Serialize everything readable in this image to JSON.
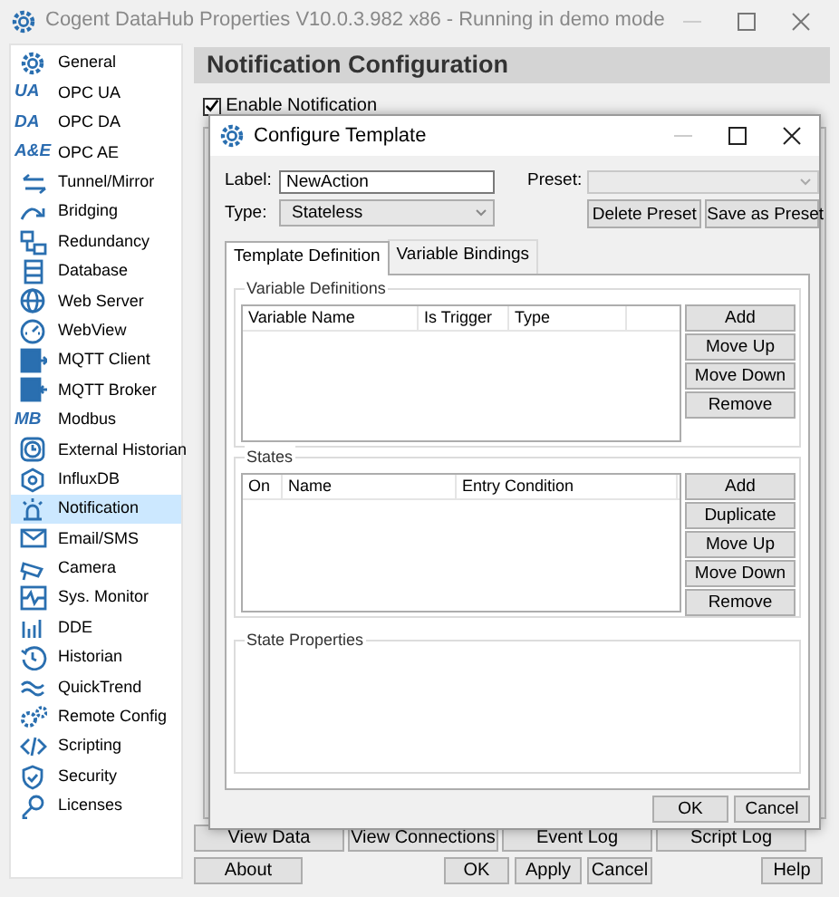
{
  "window": {
    "title": "Cogent DataHub Properties V10.0.3.982 x86 - Running in demo mode"
  },
  "sidebar": {
    "items": [
      {
        "label": "General",
        "selected": false
      },
      {
        "label": "OPC UA",
        "badge": "UA",
        "selected": false
      },
      {
        "label": "OPC DA",
        "badge": "DA",
        "selected": false
      },
      {
        "label": "OPC AE",
        "badge": "A&E",
        "selected": false
      },
      {
        "label": "Tunnel/Mirror",
        "selected": false
      },
      {
        "label": "Bridging",
        "selected": false
      },
      {
        "label": "Redundancy",
        "selected": false
      },
      {
        "label": "Database",
        "selected": false
      },
      {
        "label": "Web Server",
        "selected": false
      },
      {
        "label": "WebView",
        "selected": false
      },
      {
        "label": "MQTT Client",
        "selected": false
      },
      {
        "label": "MQTT Broker",
        "selected": false
      },
      {
        "label": "Modbus",
        "badge": "MB",
        "selected": false
      },
      {
        "label": "External Historian",
        "selected": false
      },
      {
        "label": "InfluxDB",
        "selected": false
      },
      {
        "label": "Notification",
        "selected": true
      },
      {
        "label": "Email/SMS",
        "selected": false
      },
      {
        "label": "Camera",
        "selected": false
      },
      {
        "label": "Sys. Monitor",
        "selected": false
      },
      {
        "label": "DDE",
        "selected": false
      },
      {
        "label": "Historian",
        "selected": false
      },
      {
        "label": "QuickTrend",
        "selected": false
      },
      {
        "label": "Remote Config",
        "selected": false
      },
      {
        "label": "Scripting",
        "selected": false
      },
      {
        "label": "Security",
        "selected": false
      },
      {
        "label": "Licenses",
        "selected": false
      }
    ]
  },
  "page": {
    "header": "Notification Configuration",
    "enable_notification": {
      "label": "Enable Notification",
      "checked": true
    }
  },
  "bottom_buttons": [
    [
      "View Data",
      "View Connections",
      "Event Log",
      "Script Log"
    ],
    [
      "About",
      "OK",
      "Apply",
      "Cancel",
      "Help"
    ]
  ],
  "dialog": {
    "title": "Configure Template",
    "label_field": {
      "label": "Label:",
      "value": "NewAction"
    },
    "type_field": {
      "label": "Type:",
      "value": "Stateless"
    },
    "preset": {
      "label": "Preset:",
      "disabled": true
    },
    "preset_buttons": [
      "Delete Preset",
      "Save as Preset"
    ],
    "tabs": [
      {
        "label": "Template Definition",
        "selected": true
      },
      {
        "label": "Variable Bindings",
        "selected": false
      }
    ],
    "variable_definitions": {
      "title": "Variable Definitions",
      "columns": [
        "Variable Name",
        "Is Trigger",
        "Type"
      ],
      "buttons": [
        "Add",
        "Move Up",
        "Move Down",
        "Remove"
      ]
    },
    "states": {
      "title": "States",
      "columns": [
        "On",
        "Name",
        "Entry Condition"
      ],
      "buttons": [
        "Add",
        "Duplicate",
        "Move Up",
        "Move Down",
        "Remove"
      ]
    },
    "state_properties": {
      "title": "State Properties"
    },
    "buttons": [
      "OK",
      "Cancel"
    ]
  }
}
